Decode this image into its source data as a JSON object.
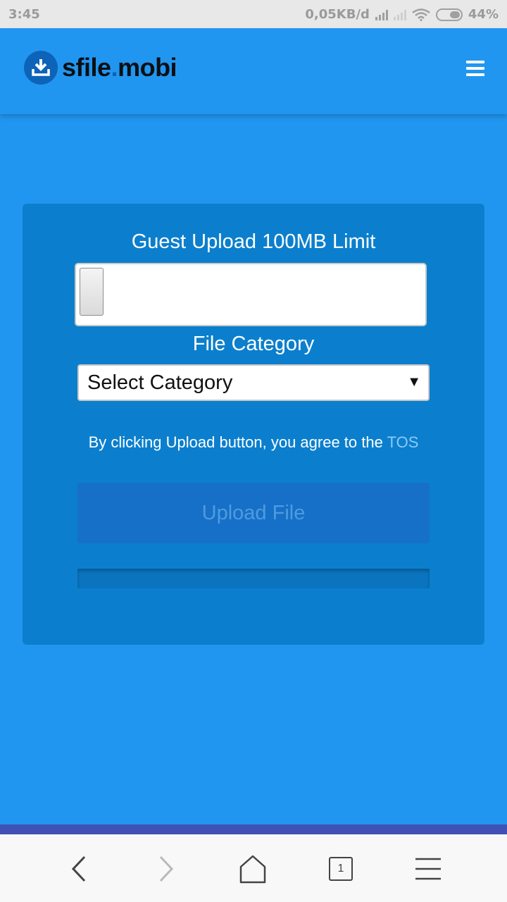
{
  "status_bar": {
    "time": "3:45",
    "network_speed": "0,05KB/d",
    "battery": "44%"
  },
  "header": {
    "logo_main": "sfile",
    "logo_dot": ".",
    "logo_tld": "mobi",
    "menu_icon": "hamburger-icon"
  },
  "upload": {
    "title": "Guest Upload 100MB Limit",
    "category_label": "File Category",
    "category_selected": "Select Category",
    "tos_text": "By clicking Upload button, you agree to the ",
    "tos_link": "TOS",
    "upload_button": "Upload File",
    "progress": 0
  },
  "colors": {
    "background": "#2196f0",
    "card": "#0b7fcd",
    "logo_accent": "#0d63b8",
    "nav_accent": "#3f51b5"
  },
  "bottom_nav": {
    "tab_count": "1",
    "icons": [
      "back-icon",
      "forward-icon",
      "home-icon",
      "tabs-icon",
      "menu-icon"
    ]
  }
}
